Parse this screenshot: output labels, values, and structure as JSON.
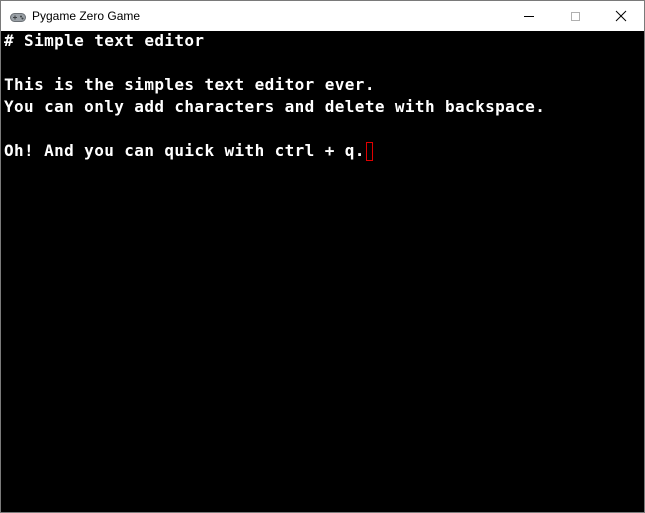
{
  "window": {
    "title": "Pygame Zero Game",
    "icon": "gamepad-icon",
    "controls": [
      "minimize-icon",
      "maximize-icon",
      "close-icon"
    ]
  },
  "editor": {
    "lines": [
      "# Simple text editor",
      "This is the simples text editor ever.",
      "You can only add characters and delete with backspace.",
      "Oh! And you can quick with ctrl + q."
    ],
    "cursor_color": "#e00000",
    "text_color": "#ffffff",
    "background": "#000000"
  }
}
